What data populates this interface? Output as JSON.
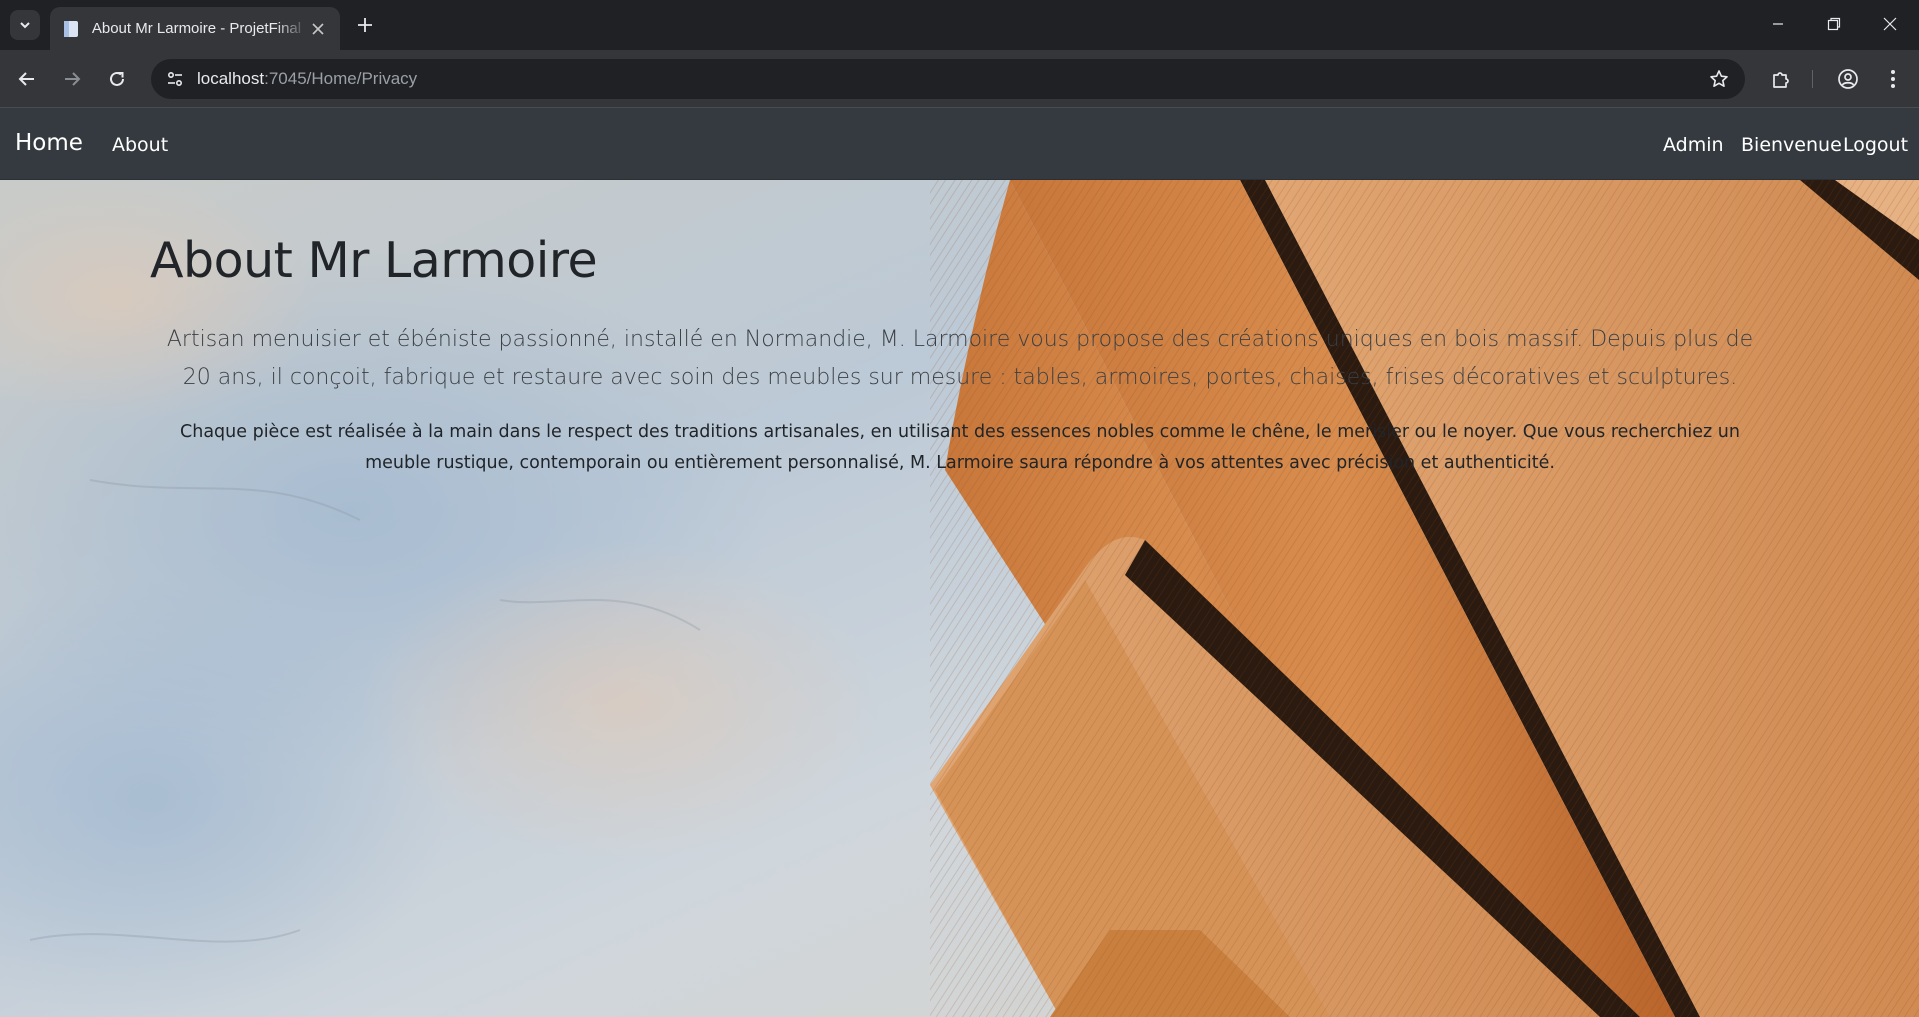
{
  "browser": {
    "tab": {
      "title": "About Mr Larmoire - ProjetFinal",
      "favicon": "document-icon"
    },
    "url": {
      "host": "localhost",
      "path": ":7045/Home/Privacy"
    }
  },
  "navbar": {
    "brand": "Home",
    "links": {
      "about": "About",
      "admin": "Admin",
      "welcome": "Bienvenue",
      "logout": "Logout"
    },
    "bg_color": "#343a40"
  },
  "page": {
    "title": "About Mr Larmoire",
    "lead": "Artisan menuisier et ébéniste passionné, installé en Normandie, M. Larmoire vous propose des créations uniques en bois massif. Depuis plus de 20 ans, il conçoit, fabrique et restaure avec soin des meubles sur mesure : tables, armoires, portes, chaises, frises décoratives et sculptures.",
    "body": "Chaque pièce est réalisée à la main dans le respect des traditions artisanales, en utilisant des essences nobles comme le chêne, le merisier ou le noyer. Que vous recherchiez un meuble rustique, contemporain ou entièrement personnalisé, M. Larmoire saura répondre à vos attentes avec précision et authenticité."
  }
}
